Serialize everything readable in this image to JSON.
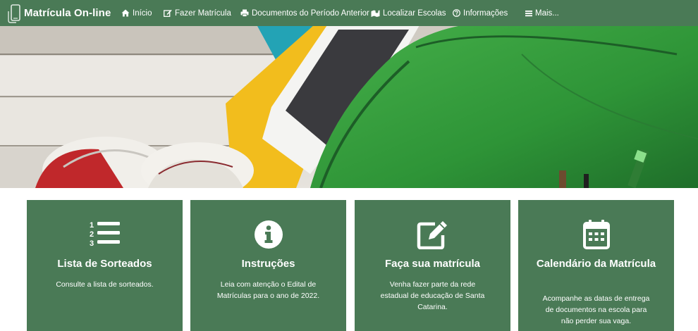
{
  "brand": {
    "name": "Matrícula On-line"
  },
  "nav": [
    {
      "label": "Início",
      "icon": "home-icon"
    },
    {
      "label": "Fazer Matrícula",
      "icon": "edit-icon"
    },
    {
      "label": "Documentos do Período Anterior",
      "icon": "print-icon"
    },
    {
      "label": "Localizar Escolas",
      "icon": "map-icon"
    },
    {
      "label": "Informações",
      "icon": "question-circle-icon"
    },
    {
      "label": "Mais...",
      "icon": "bars-icon"
    }
  ],
  "cards": [
    {
      "title": "Lista de Sorteados",
      "desc": "Consulte a lista de sorteados.",
      "icon": "numbered-list-icon"
    },
    {
      "title": "Instruções",
      "desc": "Leia com atenção o Edital de Matrículas para o ano de 2022.",
      "icon": "info-circle-icon"
    },
    {
      "title": "Faça sua matrícula",
      "desc": "Venha fazer parte da rede estadual de educação de Santa Catarina.",
      "icon": "edit-square-icon"
    },
    {
      "title": "Calendário da Matrícula",
      "desc": "Acompanhe as datas de entrega de documentos na escola para não perder sua vaga.",
      "icon": "calendar-icon"
    }
  ],
  "colors": {
    "primary": "#4a7a56",
    "text": "#ffffff"
  }
}
